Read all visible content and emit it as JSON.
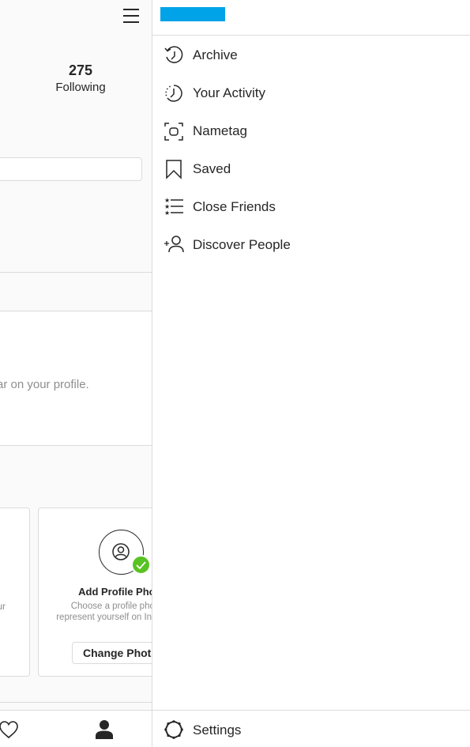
{
  "profile": {
    "following_count": "275",
    "following_label": "Following",
    "hint_text": "ar on your profile.",
    "card_left_text": "ur",
    "card": {
      "title": "Add Profile Photo",
      "description_line1": "Choose a profile photo to",
      "description_line2": "represent yourself on Instagram.",
      "button_label": "Change Photo"
    }
  },
  "drawer": {
    "username": "",
    "menu": [
      {
        "icon": "archive-icon",
        "label": "Archive"
      },
      {
        "icon": "activity-icon",
        "label": "Your Activity"
      },
      {
        "icon": "nametag-icon",
        "label": "Nametag"
      },
      {
        "icon": "saved-icon",
        "label": "Saved"
      },
      {
        "icon": "close-friends-icon",
        "label": "Close Friends"
      },
      {
        "icon": "discover-people-icon",
        "label": "Discover People"
      }
    ],
    "footer": {
      "icon": "settings-icon",
      "label": "Settings"
    }
  },
  "colors": {
    "redaction": "#00a2e8",
    "check_badge": "#58c322"
  }
}
